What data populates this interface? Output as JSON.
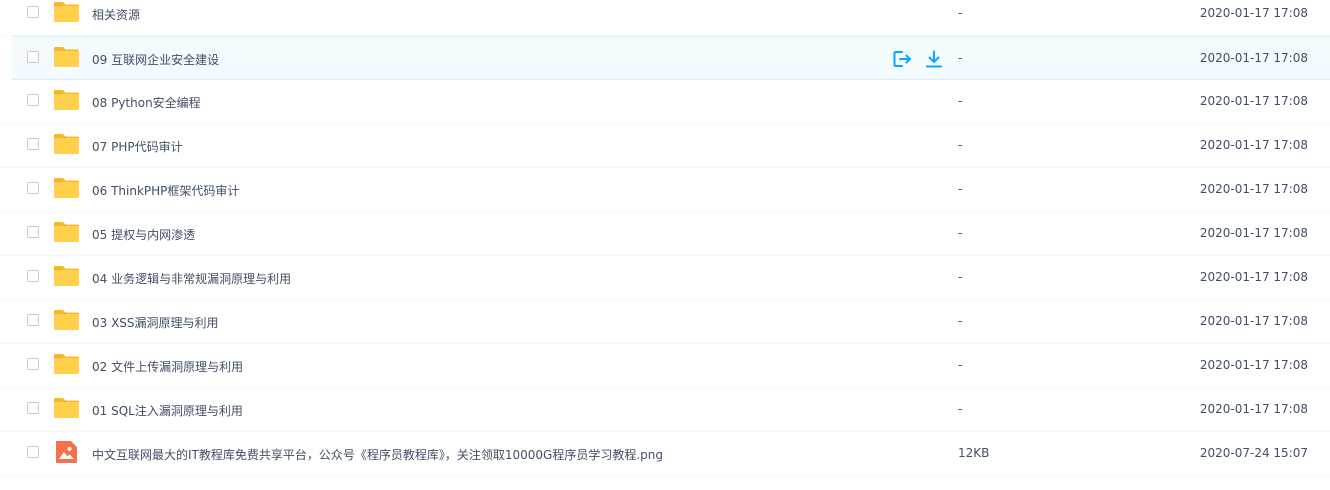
{
  "files": [
    {
      "name": "相关资源",
      "size": "-",
      "modified": "2020-01-17 17:08",
      "type": "folder",
      "icon": "folder-icon"
    },
    {
      "name": "09 互联网企业安全建设",
      "size": "-",
      "modified": "2020-01-17 17:08",
      "type": "folder",
      "icon": "folder-icon",
      "hovered": true
    },
    {
      "name": "08 Python安全编程",
      "size": "-",
      "modified": "2020-01-17 17:08",
      "type": "folder",
      "icon": "folder-icon"
    },
    {
      "name": "07 PHP代码审计",
      "size": "-",
      "modified": "2020-01-17 17:08",
      "type": "folder",
      "icon": "folder-icon"
    },
    {
      "name": "06 ThinkPHP框架代码审计",
      "size": "-",
      "modified": "2020-01-17 17:08",
      "type": "folder",
      "icon": "folder-icon"
    },
    {
      "name": "05 提权与内网渗透",
      "size": "-",
      "modified": "2020-01-17 17:08",
      "type": "folder",
      "icon": "folder-icon"
    },
    {
      "name": "04 业务逻辑与非常规漏洞原理与利用",
      "size": "-",
      "modified": "2020-01-17 17:08",
      "type": "folder",
      "icon": "folder-icon"
    },
    {
      "name": "03 XSS漏洞原理与利用",
      "size": "-",
      "modified": "2020-01-17 17:08",
      "type": "folder",
      "icon": "folder-icon"
    },
    {
      "name": "02 文件上传漏洞原理与利用",
      "size": "-",
      "modified": "2020-01-17 17:08",
      "type": "folder",
      "icon": "folder-icon"
    },
    {
      "name": "01 SQL注入漏洞原理与利用",
      "size": "-",
      "modified": "2020-01-17 17:08",
      "type": "folder",
      "icon": "folder-icon"
    },
    {
      "name": "中文互联网最大的IT教程库免费共享平台，公众号《程序员教程库》，关注领取10000G程序员学习教程.png",
      "size": "12KB",
      "modified": "2020-07-24 15:07",
      "type": "image",
      "icon": "image-file-icon"
    }
  ],
  "row_actions": [
    {
      "name": "share-button",
      "icon": "share-icon"
    },
    {
      "name": "download-button",
      "icon": "download-icon"
    }
  ],
  "colors": {
    "folder": "#ffd04b",
    "folder_tab": "#f5b82a",
    "image_file": "#f5714a",
    "action_blue": "#06a7ff",
    "text": "#424e67",
    "hover_bg": "#f4fbff"
  }
}
